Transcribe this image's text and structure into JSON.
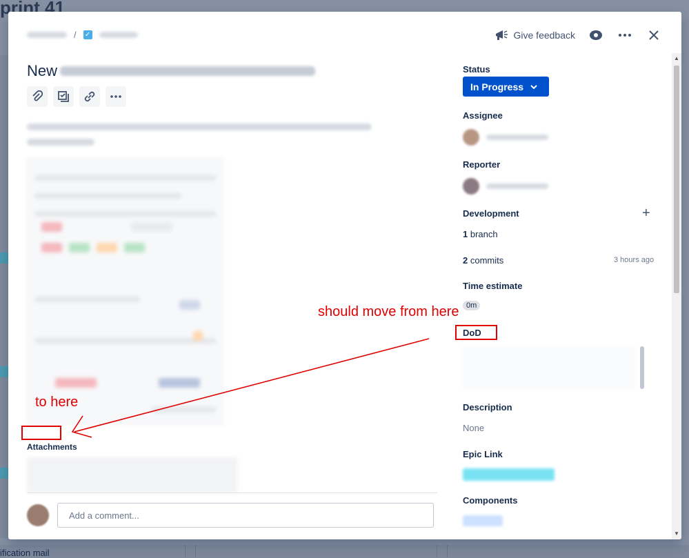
{
  "background": {
    "board_title": "print 41",
    "footer_text": "ification mail"
  },
  "modal": {
    "topbar": {
      "feedback_label": "Give feedback",
      "watch_icon": "eye-icon",
      "more_icon": "more-icon",
      "close_icon": "close-icon"
    },
    "title_prefix": "New",
    "toolbar": [
      "paperclip-icon",
      "child-issue-icon",
      "link-icon",
      "more-icon"
    ],
    "attachments_label": "Attachments",
    "comment_placeholder": "Add a comment...",
    "fields": {
      "status_label": "Status",
      "status_value": "In Progress",
      "assignee_label": "Assignee",
      "reporter_label": "Reporter",
      "development_label": "Development",
      "branch_count": "1",
      "branch_text": "branch",
      "commit_count": "2",
      "commit_text": "commits",
      "commit_time": "3 hours ago",
      "time_estimate_label": "Time estimate",
      "time_estimate_value": "0m",
      "dod_label": "DoD",
      "description_label": "Description",
      "description_value": "None",
      "epic_link_label": "Epic Link",
      "components_label": "Components"
    }
  },
  "annotations": {
    "from_text": "should move from here",
    "to_text": "to here",
    "color": "#e00000"
  },
  "colors": {
    "primary": "#0052cc",
    "text": "#172b4d",
    "subtle": "#6b778c"
  }
}
